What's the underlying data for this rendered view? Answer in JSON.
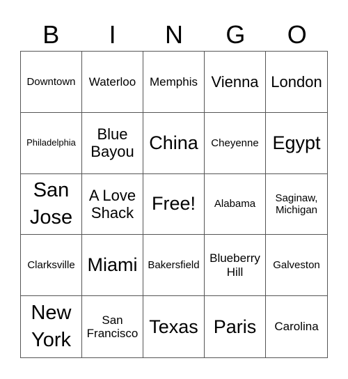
{
  "header": {
    "letters": [
      "B",
      "I",
      "N",
      "G",
      "O"
    ]
  },
  "grid": {
    "rows": [
      [
        {
          "text": "Downtown",
          "size": "s-sm"
        },
        {
          "text": "Waterloo",
          "size": "s-md"
        },
        {
          "text": "Memphis",
          "size": "s-md"
        },
        {
          "text": "Vienna",
          "size": "s-lg"
        },
        {
          "text": "London",
          "size": "s-lg"
        }
      ],
      [
        {
          "text": "Philadelphia",
          "size": "s-xs"
        },
        {
          "text": "Blue Bayou",
          "size": "s-lg"
        },
        {
          "text": "China",
          "size": "s-xl"
        },
        {
          "text": "Cheyenne",
          "size": "s-sm"
        },
        {
          "text": "Egypt",
          "size": "s-xl"
        }
      ],
      [
        {
          "text": "San Jose",
          "size": "s-xxl"
        },
        {
          "text": "A Love Shack",
          "size": "s-lg"
        },
        {
          "text": "Free!",
          "size": "s-xl",
          "free": true
        },
        {
          "text": "Alabama",
          "size": "s-sm"
        },
        {
          "text": "Saginaw, Michigan",
          "size": "s-sm"
        }
      ],
      [
        {
          "text": "Clarksville",
          "size": "s-sm"
        },
        {
          "text": "Miami",
          "size": "s-xl"
        },
        {
          "text": "Bakersfield",
          "size": "s-sm"
        },
        {
          "text": "Blueberry Hill",
          "size": "s-md"
        },
        {
          "text": "Galveston",
          "size": "s-sm"
        }
      ],
      [
        {
          "text": "New York",
          "size": "s-xxl"
        },
        {
          "text": "San Francisco",
          "size": "s-md"
        },
        {
          "text": "Texas",
          "size": "s-xl"
        },
        {
          "text": "Paris",
          "size": "s-xl"
        },
        {
          "text": "Carolina",
          "size": "s-md"
        }
      ]
    ]
  }
}
